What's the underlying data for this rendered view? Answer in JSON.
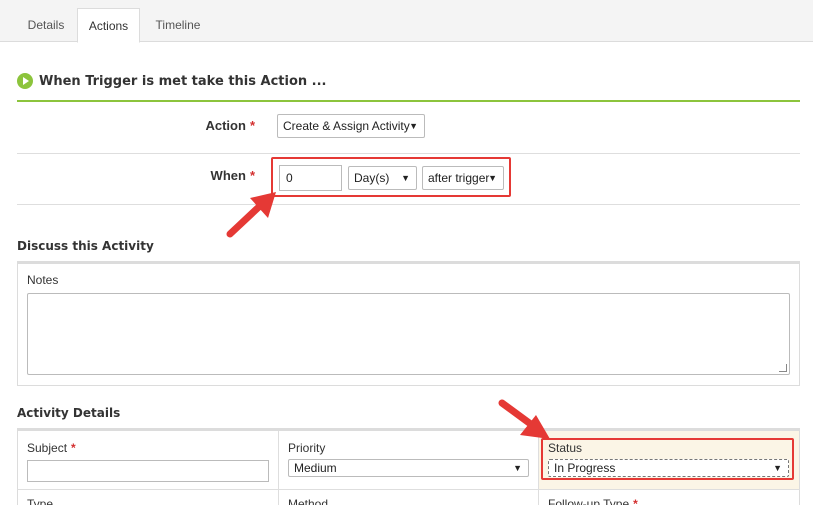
{
  "tabs": [
    {
      "label": "Details"
    },
    {
      "label": "Actions",
      "active": true
    },
    {
      "label": "Timeline"
    }
  ],
  "section": {
    "title": "When Trigger is met take this Action ..."
  },
  "action": {
    "label": "Action",
    "required_mark": "*",
    "value": "Create & Assign Activity"
  },
  "when": {
    "label": "When",
    "required_mark": "*",
    "amount": "0",
    "unit": "Day(s)",
    "relation": "after trigger"
  },
  "discuss": {
    "title": "Discuss this Activity",
    "notes_label": "Notes",
    "notes_value": ""
  },
  "details": {
    "title": "Activity Details",
    "subject_label": "Subject",
    "subject_required": "*",
    "subject_value": "",
    "priority_label": "Priority",
    "priority_value": "Medium",
    "status_label": "Status",
    "status_value": "In Progress",
    "row2": {
      "col1": "Type",
      "col2": "Method",
      "col3": "Follow-up Type",
      "col3_required": "*"
    }
  },
  "colors": {
    "accent_green": "#8cc43c",
    "highlight_red": "#e53935",
    "required_red": "#d32f2f"
  }
}
